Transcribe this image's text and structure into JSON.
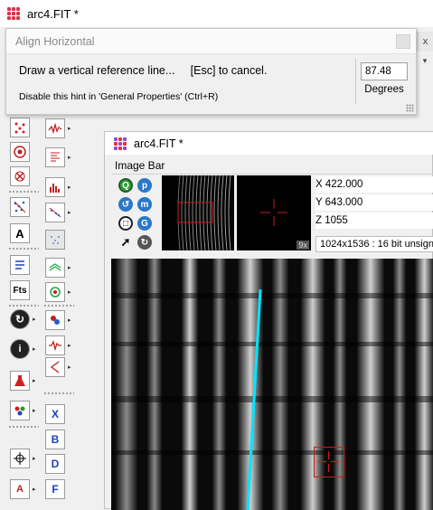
{
  "app": {
    "title": "arc4.FIT *"
  },
  "hint": {
    "title": "Align Horizontal",
    "message": "Draw a vertical reference line...     [Esc] to cancel.",
    "sub_message": "Disable this hint in 'General Properties' (Ctrl+R)",
    "degrees_value": "87.48",
    "degrees_label": "Degrees"
  },
  "child": {
    "title": "arc4.FIT *",
    "image_bar_label": "Image Bar",
    "x_label": "X 422.000",
    "y_label": "Y 643.000",
    "z_label": "Z 1055",
    "zoom_label": "9x",
    "info_label": "1024x1536 : 16 bit unsign"
  },
  "toolbar_left": [
    "star-points-tool",
    "target-tool",
    "x-marker-tool",
    "scatter-tool",
    "text-tool",
    "import-tool",
    "fits-header-tool",
    "mode-switch-tool",
    "info-tool",
    "flask-tool",
    "color-dots-tool",
    "crosshair-tool",
    "font-tool"
  ],
  "toolbar_right_letters": {
    "x": "X",
    "b": "B",
    "d": "D",
    "f": "F"
  },
  "colors": {
    "reference_line": "#00e5ff",
    "marker": "#d01818",
    "app_icon": "#d9334a",
    "child_icon": "#9b49c9"
  }
}
